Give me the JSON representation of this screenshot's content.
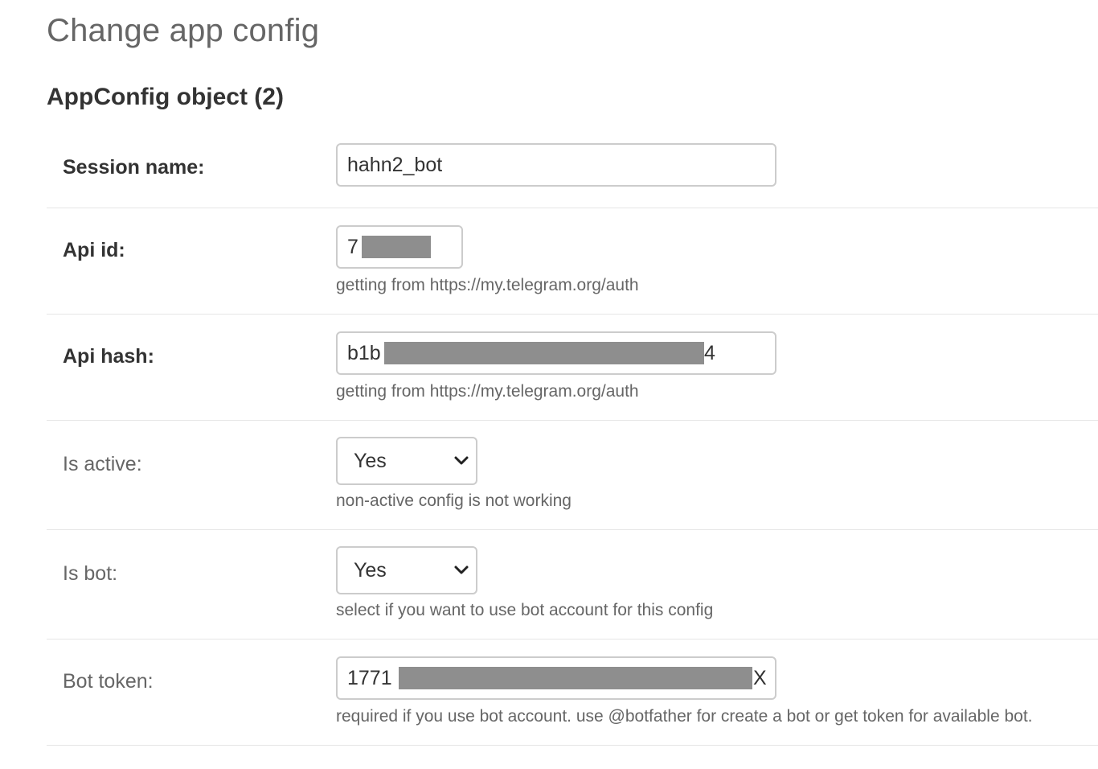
{
  "page_title": "Change app config",
  "object_title": "AppConfig object (2)",
  "fields": {
    "session_name": {
      "label": "Session name:",
      "value": "hahn2_bot"
    },
    "api_id": {
      "label": "Api id:",
      "value_prefix": "7",
      "help": "getting from https://my.telegram.org/auth"
    },
    "api_hash": {
      "label": "Api hash:",
      "value_prefix": "b1b",
      "value_suffix": "4",
      "help": "getting from https://my.telegram.org/auth"
    },
    "is_active": {
      "label": "Is active:",
      "selected": "Yes",
      "help": "non-active config is not working"
    },
    "is_bot": {
      "label": "Is bot:",
      "selected": "Yes",
      "help": "select if you want to use bot account for this config"
    },
    "bot_token": {
      "label": "Bot token:",
      "value_prefix": "1771",
      "value_suffix": "X",
      "help": "required if you use bot account. use @botfather for create a bot or get token for available bot."
    }
  },
  "colors": {
    "border": "#cccccc",
    "redaction": "#8e8e8e",
    "divider": "#e6e6e6",
    "muted_text": "#666666",
    "text": "#333333"
  }
}
